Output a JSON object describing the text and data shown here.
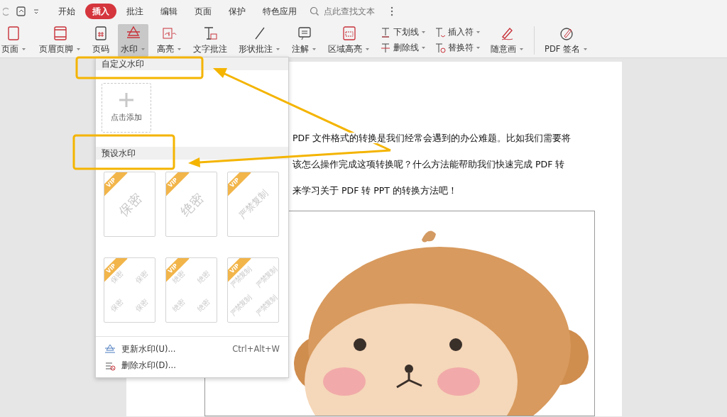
{
  "tabs": [
    {
      "label": "开始",
      "selected": false
    },
    {
      "label": "插入",
      "selected": true
    },
    {
      "label": "批注",
      "selected": false
    },
    {
      "label": "编辑",
      "selected": false
    },
    {
      "label": "页面",
      "selected": false
    },
    {
      "label": "保护",
      "selected": false
    },
    {
      "label": "特色应用",
      "selected": false
    }
  ],
  "search": {
    "placeholder": "点此查找文本"
  },
  "ribbon": [
    {
      "kind": "large",
      "label": "页面",
      "dropdown": true,
      "selected": false
    },
    {
      "kind": "large",
      "label": "页眉页脚",
      "dropdown": true,
      "selected": false
    },
    {
      "kind": "large",
      "label": "页码",
      "dropdown": false,
      "selected": false
    },
    {
      "kind": "large",
      "label": "水印",
      "dropdown": true,
      "selected": true
    },
    {
      "kind": "large",
      "label": "高亮",
      "dropdown": true,
      "selected": false
    },
    {
      "kind": "large",
      "label": "文字批注",
      "dropdown": false,
      "selected": false
    },
    {
      "kind": "large",
      "label": "形状批注",
      "dropdown": true,
      "selected": false
    },
    {
      "kind": "large",
      "label": "注解",
      "dropdown": true,
      "selected": false
    },
    {
      "kind": "large",
      "label": "区域高亮",
      "dropdown": true,
      "selected": false
    },
    {
      "kind": "stack",
      "buttons": [
        {
          "label": "下划线",
          "dropdown": true
        },
        {
          "label": "删除线",
          "dropdown": true
        }
      ]
    },
    {
      "kind": "stack",
      "buttons": [
        {
          "label": "插入符",
          "dropdown": true
        },
        {
          "label": "替换符",
          "dropdown": true
        }
      ]
    },
    {
      "kind": "large",
      "label": "随意画",
      "dropdown": true,
      "selected": false
    },
    {
      "kind": "separator"
    },
    {
      "kind": "large",
      "label": "PDF 签名",
      "dropdown": true,
      "selected": false
    }
  ],
  "watermark_menu": {
    "custom_title": "自定义水印",
    "add_label": "点击添加",
    "preset_title": "预设水印",
    "presets": [
      {
        "kind": "single",
        "badge": "VIP",
        "texts": [
          "保密"
        ]
      },
      {
        "kind": "single",
        "badge": "VIP",
        "texts": [
          "绝密"
        ]
      },
      {
        "kind": "single",
        "badge": "VIP",
        "texts": [
          "严禁复制"
        ]
      },
      {
        "kind": "tiled",
        "badge": "VIP",
        "texts": [
          "保密",
          "保密",
          "保密",
          "保密"
        ]
      },
      {
        "kind": "tiled",
        "badge": "VIP",
        "texts": [
          "绝密",
          "绝密",
          "绝密",
          "绝密"
        ]
      },
      {
        "kind": "tiled",
        "badge": "VIP",
        "texts": [
          "严禁复制",
          "严禁复制",
          "严禁复制",
          "严禁复制"
        ]
      }
    ],
    "actions": [
      {
        "label": "更新水印(U)...",
        "shortcut": "Ctrl+Alt+W"
      },
      {
        "label": "删除水印(D)..."
      }
    ]
  },
  "document": {
    "lines": [
      "PDF 文件格式的转换是我们经常会遇到的办公难题。比如我们需要将",
      "该怎么操作完成这项转换呢？什么方法能帮助我们快速完成 PDF 转",
      "来学习关于 PDF 转 PPT 的转换方法吧！"
    ]
  }
}
